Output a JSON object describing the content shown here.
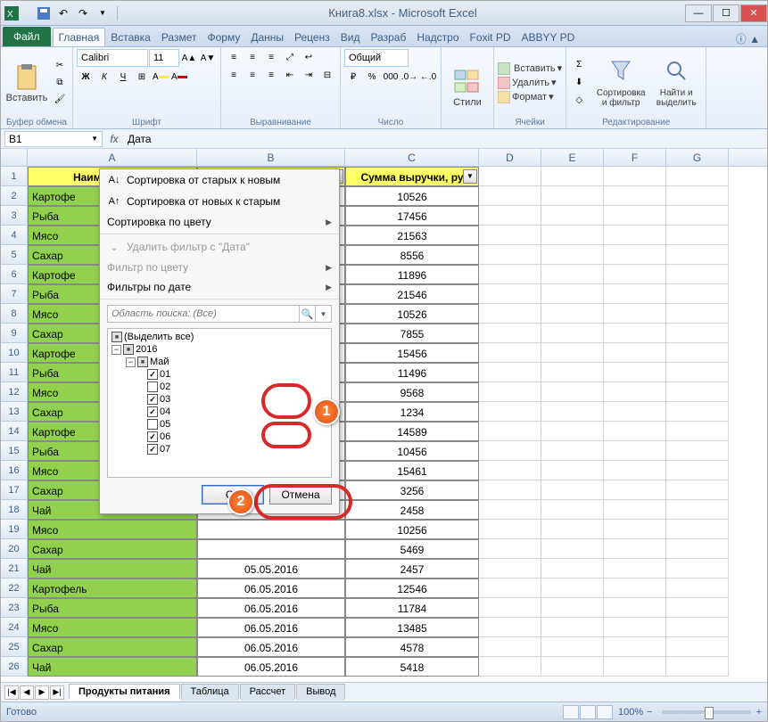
{
  "titlebar": {
    "title": "Книга8.xlsx - Microsoft Excel"
  },
  "ribbon": {
    "file": "Файл",
    "tabs": [
      "Главная",
      "Вставка",
      "Размет",
      "Форму",
      "Данны",
      "Реценз",
      "Вид",
      "Разраб",
      "Надстро",
      "Foxit PD",
      "ABBYY PD"
    ],
    "active_tab": 0,
    "groups": {
      "clipboard_label": "Буфер обмена",
      "paste": "Вставить",
      "font_label": "Шрифт",
      "font_name": "Calibri",
      "font_size": "11",
      "align_label": "Выравнивание",
      "number_label": "Число",
      "number_format": "Общий",
      "styles_label": "",
      "styles_btn": "Стили",
      "cells_label": "Ячейки",
      "insert": "Вставить",
      "delete": "Удалить",
      "format": "Формат",
      "editing_label": "Редактирование",
      "sort": "Сортировка\nи фильтр",
      "find": "Найти и\nвыделить"
    }
  },
  "formula": {
    "name_box": "B1",
    "value": "Дата"
  },
  "columns": [
    {
      "key": "A",
      "w": 190
    },
    {
      "key": "B",
      "w": 166
    },
    {
      "key": "C",
      "w": 150
    },
    {
      "key": "D",
      "w": 70
    },
    {
      "key": "E",
      "w": 70
    },
    {
      "key": "F",
      "w": 70
    },
    {
      "key": "G",
      "w": 70
    }
  ],
  "headers": {
    "A": "Наименование",
    "B": "Дата",
    "C": "Сумма выручки, ру"
  },
  "rows": [
    {
      "n": 1,
      "a": "",
      "c": ""
    },
    {
      "n": 2,
      "a": "Картофе",
      "c": "10526"
    },
    {
      "n": 3,
      "a": "Рыба",
      "c": "17456"
    },
    {
      "n": 4,
      "a": "Мясо",
      "c": "21563"
    },
    {
      "n": 5,
      "a": "Сахар",
      "c": "8556"
    },
    {
      "n": 6,
      "a": "Картофе",
      "c": "11896"
    },
    {
      "n": 7,
      "a": "Рыба",
      "c": "21546"
    },
    {
      "n": 8,
      "a": "Мясо",
      "c": "10526"
    },
    {
      "n": 9,
      "a": "Сахар",
      "c": "7855"
    },
    {
      "n": 10,
      "a": "Картофе",
      "c": "15456"
    },
    {
      "n": 11,
      "a": "Рыба",
      "c": "11496"
    },
    {
      "n": 12,
      "a": "Мясо",
      "c": "9568"
    },
    {
      "n": 13,
      "a": "Сахар",
      "c": "1234"
    },
    {
      "n": 14,
      "a": "Картофе",
      "c": "14589"
    },
    {
      "n": 15,
      "a": "Рыба",
      "c": "10456"
    },
    {
      "n": 16,
      "a": "Мясо",
      "c": "15461"
    },
    {
      "n": 17,
      "a": "Сахар",
      "c": "3256"
    },
    {
      "n": 18,
      "a": "Чай",
      "c": "2458"
    },
    {
      "n": 19,
      "a": "Мясо",
      "c": "10256"
    },
    {
      "n": 20,
      "a": "Сахар",
      "c": "5469"
    },
    {
      "n": 21,
      "a": "Чай",
      "b": "05.05.2016",
      "c": "2457"
    },
    {
      "n": 22,
      "a": "Картофель",
      "b": "06.05.2016",
      "c": "12546"
    },
    {
      "n": 23,
      "a": "Рыба",
      "b": "06.05.2016",
      "c": "11784"
    },
    {
      "n": 24,
      "a": "Мясо",
      "b": "06.05.2016",
      "c": "13485"
    },
    {
      "n": 25,
      "a": "Сахар",
      "b": "06.05.2016",
      "c": "4578"
    },
    {
      "n": 26,
      "a": "Чай",
      "b": "06.05.2016",
      "c": "5418"
    }
  ],
  "filter": {
    "sort_asc": "Сортировка от старых к новым",
    "sort_desc": "Сортировка от новых к старым",
    "sort_color": "Сортировка по цвету",
    "clear": "Удалить фильтр с \"Дата\"",
    "filter_color": "Фильтр по цвету",
    "date_filters": "Фильтры по дате",
    "search_placeholder": "Область поиска: (Все)",
    "select_all": "(Выделить все)",
    "year": "2016",
    "month": "Май",
    "days": [
      {
        "label": "01",
        "checked": true
      },
      {
        "label": "02",
        "checked": false
      },
      {
        "label": "03",
        "checked": true
      },
      {
        "label": "04",
        "checked": true
      },
      {
        "label": "05",
        "checked": false
      },
      {
        "label": "06",
        "checked": true
      },
      {
        "label": "07",
        "checked": true
      }
    ],
    "ok": "ОК",
    "cancel": "Отмена"
  },
  "sheets": {
    "tabs": [
      "Продукты питания",
      "Таблица",
      "Рассчет",
      "Вывод"
    ],
    "active": 0
  },
  "status": {
    "ready": "Готово",
    "zoom": "100%"
  },
  "annotations": {
    "b1": "1",
    "b2": "2"
  }
}
